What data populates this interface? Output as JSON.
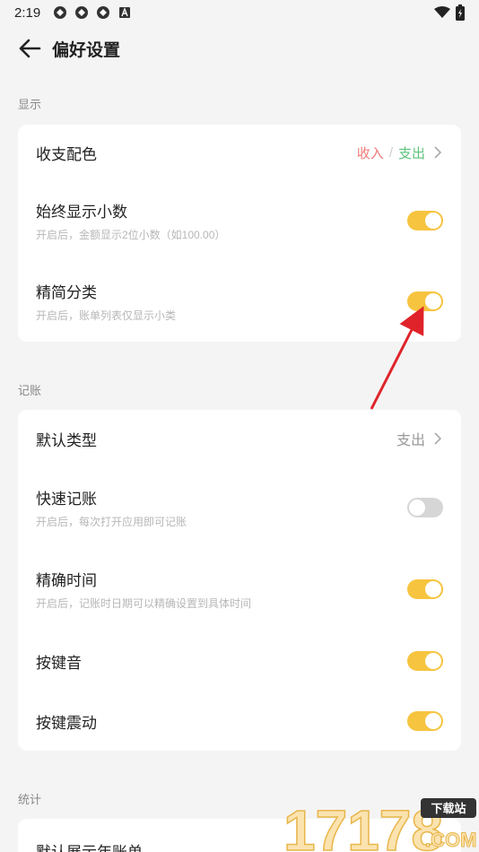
{
  "status": {
    "time": "2:19"
  },
  "header": {
    "title": "偏好设置"
  },
  "display": {
    "label": "显示",
    "color_row": {
      "label": "收支配色",
      "income": "收入",
      "sep": "/",
      "expense": "支出"
    },
    "decimals": {
      "label": "始终显示小数",
      "sub": "开启后，金额显示2位小数（如100.00）",
      "on": true
    },
    "simple_category": {
      "label": "精简分类",
      "sub": "开启后，账单列表仅显示小类",
      "on": true
    }
  },
  "bookkeeping": {
    "label": "记账",
    "default_type": {
      "label": "默认类型",
      "value": "支出"
    },
    "quick": {
      "label": "快速记账",
      "sub": "开启后，每次打开应用即可记账",
      "on": false
    },
    "precise_time": {
      "label": "精确时间",
      "sub": "开启后，记账时日期可以精确设置到具体时间",
      "on": true
    },
    "key_sound": {
      "label": "按键音",
      "on": true
    },
    "key_vibrate": {
      "label": "按键震动",
      "on": true
    }
  },
  "stats": {
    "label": "统计",
    "default_year": {
      "label": "默认展示年账单"
    }
  },
  "watermark": {
    "text": "17178",
    "badge": "下载站",
    "domain": ".COM"
  },
  "colors": {
    "accent": "#f6c43f",
    "income": "#f07a77",
    "expense": "#5fc27b",
    "arrow": "#e0232a"
  }
}
